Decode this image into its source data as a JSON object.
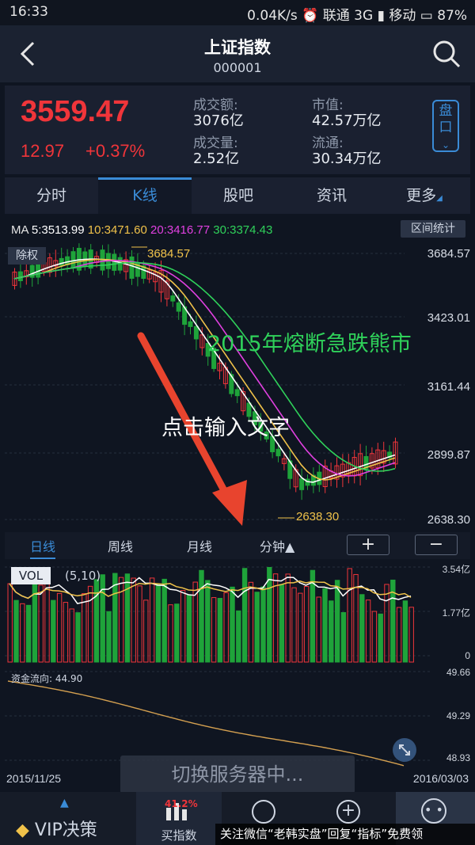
{
  "status_bar": {
    "time": "16:33",
    "speed": "0.04K/s",
    "carrier1": "联通 3G",
    "carrier2": "移动",
    "battery": "87%"
  },
  "header": {
    "title": "上证指数",
    "code": "000001",
    "back_icon": "chevron-left-icon",
    "search_icon": "search-icon"
  },
  "quote": {
    "price": "3559.47",
    "change": "12.97",
    "change_pct": "+0.37%",
    "turnover_label": "成交额:",
    "turnover_value": "3076亿",
    "volume_label": "成交量:",
    "volume_value": "2.52亿",
    "market_cap_label": "市值:",
    "market_cap_value": "42.57万亿",
    "float_label": "流通:",
    "float_value": "30.34万亿",
    "pankou_label": "盘口",
    "accent_red": "#f0353a"
  },
  "tabs": [
    {
      "label": "分时"
    },
    {
      "label": "K线"
    },
    {
      "label": "股吧"
    },
    {
      "label": "资讯"
    },
    {
      "label": "更多"
    }
  ],
  "kline": {
    "ma_prefix": "MA",
    "ma5": "5:3513.99",
    "ma10": "10:3471.60",
    "ma20": "20:3416.77",
    "ma30": "30:3374.43",
    "interval_stats": "区间统计",
    "chuquan": "除权",
    "y_ticks": [
      "3684.57",
      "3423.01",
      "3161.44",
      "2899.87",
      "2638.30"
    ],
    "peak_label": "3684.57",
    "low_label": "2638.30",
    "annotation": "2015年熔断急跌熊市",
    "input_placeholder": "点击输入文字",
    "colors": {
      "ma5": "#ffffff",
      "ma10": "#f0c24a",
      "ma20": "#e040e0",
      "ma30": "#2fd15a",
      "up": "#f0353a",
      "down": "#1fa33a",
      "arrow": "#e8442e"
    }
  },
  "periods": {
    "day": "日线",
    "week": "周线",
    "month": "月线",
    "minute": "分钟▲",
    "zoom_in": "+",
    "zoom_out": "−"
  },
  "volume": {
    "label": "VOL",
    "params": "(5,10)",
    "ticks": [
      "3.54亿",
      "1.77亿",
      "0"
    ]
  },
  "fund_flow": {
    "label": "资金流向: 44.90",
    "ticks": [
      "49.66",
      "49.29",
      "48.93"
    ],
    "date_start": "2015/11/25",
    "date_end": "2016/03/03",
    "toast": "切换服务器中...",
    "expand_icon": "expand-icon"
  },
  "bottom_nav": {
    "vip": "VIP决策",
    "buy_index": "买指数",
    "buy_index_badge": "41.2%",
    "icons": [
      "diamond-icon",
      "bar-chart-icon",
      "face-icon",
      "plus-circle-icon",
      "chat-icon"
    ]
  },
  "watermark": "关注微信“老韩实盘”回复“指标”免费领"
}
